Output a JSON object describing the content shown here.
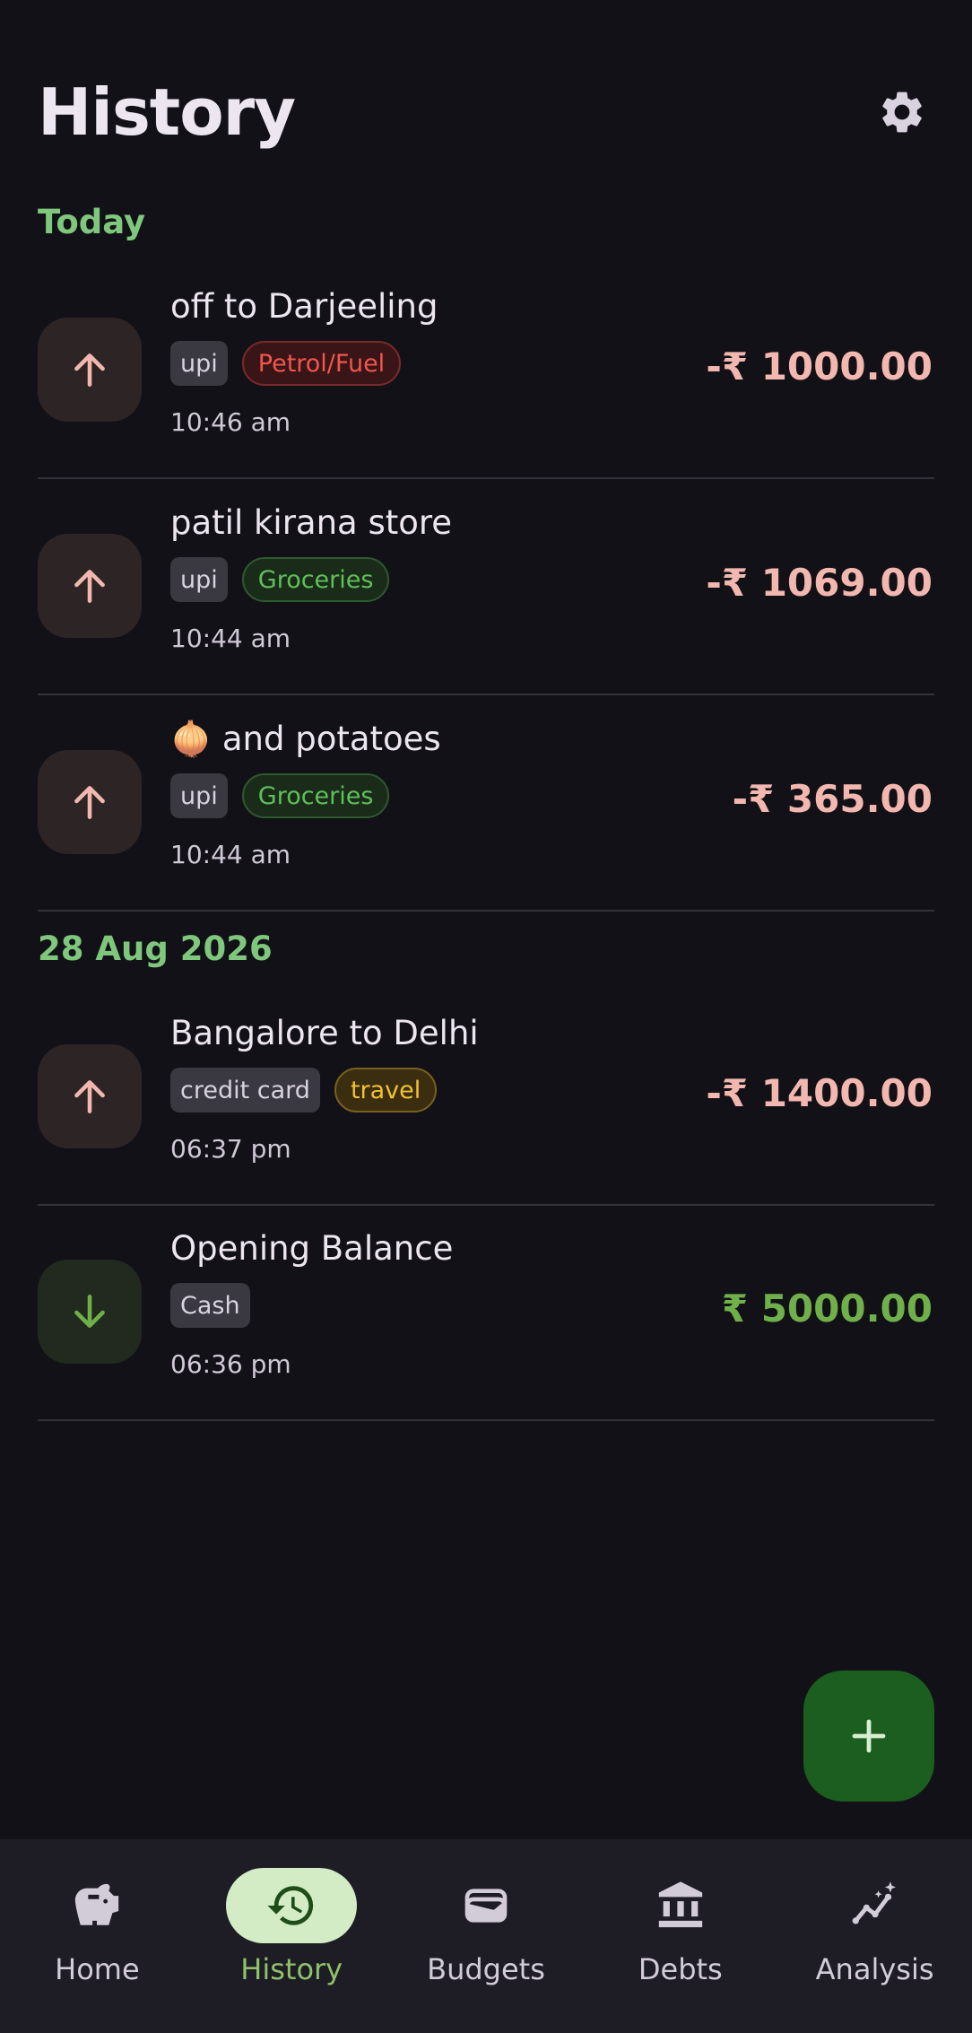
{
  "header": {
    "title": "History",
    "settings_icon": "gear-icon"
  },
  "sections": [
    {
      "label": "Today"
    },
    {
      "label": "28 Aug 2026"
    }
  ],
  "transactions": [
    {
      "title": "off to Darjeeling",
      "account": "upi",
      "category": "Petrol/Fuel",
      "time": "10:46 am",
      "amount": "-₹ 1000.00",
      "type": "expense",
      "icon": "arrow-up-icon"
    },
    {
      "title": "patil kirana store",
      "account": "upi",
      "category": "Groceries",
      "time": "10:44 am",
      "amount": "-₹ 1069.00",
      "type": "expense",
      "icon": "arrow-up-icon"
    },
    {
      "title": "🧅 and potatoes",
      "account": "upi",
      "category": "Groceries",
      "time": "10:44 am",
      "amount": "-₹ 365.00",
      "type": "expense",
      "icon": "arrow-up-icon"
    },
    {
      "title": "Bangalore to Delhi",
      "account": "credit card",
      "category": "travel",
      "time": "06:37 pm",
      "amount": "-₹ 1400.00",
      "type": "expense",
      "icon": "arrow-up-icon"
    },
    {
      "title": "Opening Balance",
      "account": "Cash",
      "category": "",
      "time": "06:36 pm",
      "amount": "₹ 5000.00",
      "type": "income",
      "icon": "arrow-down-icon"
    }
  ],
  "fab": {
    "icon": "plus-icon"
  },
  "nav": [
    {
      "label": "Home",
      "icon": "piggy-bank-icon"
    },
    {
      "label": "History",
      "icon": "history-icon",
      "active": true
    },
    {
      "label": "Budgets",
      "icon": "wallet-icon"
    },
    {
      "label": "Debts",
      "icon": "bank-icon"
    },
    {
      "label": "Analysis",
      "icon": "analytics-icon"
    }
  ],
  "colors": {
    "background": "#131118",
    "accent_green": "#7fc77c",
    "expense": "#f2b7ae",
    "income": "#6fb04a",
    "fab": "#1b5e20"
  }
}
